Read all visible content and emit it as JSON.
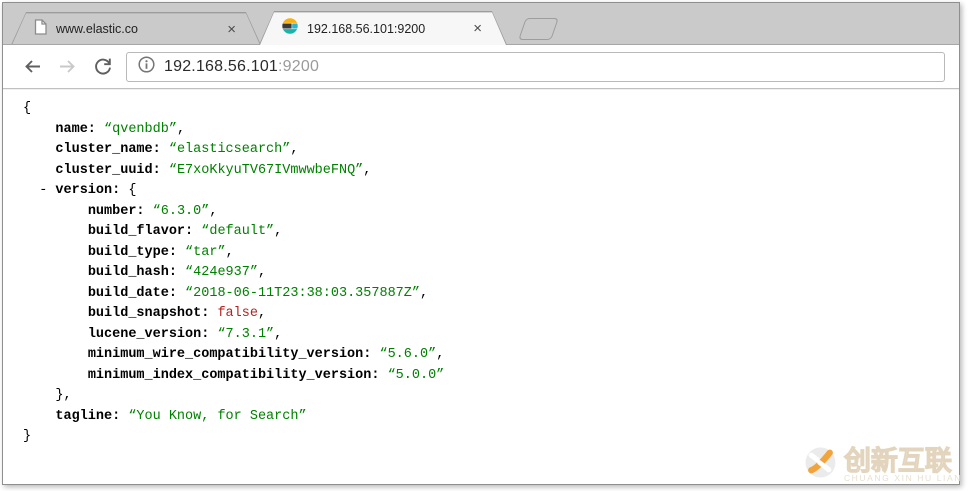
{
  "browser": {
    "tabs": [
      {
        "title": "www.elastic.co",
        "icon": "page-icon",
        "close_label": "×",
        "active": false
      },
      {
        "title": "192.168.56.101:9200",
        "icon": "elasticsearch-icon",
        "close_label": "×",
        "active": true
      }
    ],
    "address_bar": {
      "host": "192.168.56.101",
      "port": ":9200"
    }
  },
  "json_viewer": {
    "colors": {
      "key": "#000000",
      "punct": "#000000",
      "string": "#008000",
      "bool": "#b22222"
    },
    "lines": [
      [
        [
          "p",
          "{"
        ]
      ],
      [
        [
          "p",
          "    "
        ],
        [
          "k",
          "name:"
        ],
        [
          "p",
          " "
        ],
        [
          "s",
          "“qvenbdb”"
        ],
        [
          "p",
          ","
        ]
      ],
      [
        [
          "p",
          "    "
        ],
        [
          "k",
          "cluster_name:"
        ],
        [
          "p",
          " "
        ],
        [
          "s",
          "“elasticsearch”"
        ],
        [
          "p",
          ","
        ]
      ],
      [
        [
          "p",
          "    "
        ],
        [
          "k",
          "cluster_uuid:"
        ],
        [
          "p",
          " "
        ],
        [
          "s",
          "“E7xoKkyuTV67IVmwwbeFNQ”"
        ],
        [
          "p",
          ","
        ]
      ],
      [
        [
          "p",
          "  - "
        ],
        [
          "k",
          "version:"
        ],
        [
          "p",
          " {"
        ]
      ],
      [
        [
          "p",
          "        "
        ],
        [
          "k",
          "number:"
        ],
        [
          "p",
          " "
        ],
        [
          "s",
          "“6.3.0”"
        ],
        [
          "p",
          ","
        ]
      ],
      [
        [
          "p",
          "        "
        ],
        [
          "k",
          "build_flavor:"
        ],
        [
          "p",
          " "
        ],
        [
          "s",
          "“default”"
        ],
        [
          "p",
          ","
        ]
      ],
      [
        [
          "p",
          "        "
        ],
        [
          "k",
          "build_type:"
        ],
        [
          "p",
          " "
        ],
        [
          "s",
          "“tar”"
        ],
        [
          "p",
          ","
        ]
      ],
      [
        [
          "p",
          "        "
        ],
        [
          "k",
          "build_hash:"
        ],
        [
          "p",
          " "
        ],
        [
          "s",
          "“424e937”"
        ],
        [
          "p",
          ","
        ]
      ],
      [
        [
          "p",
          "        "
        ],
        [
          "k",
          "build_date:"
        ],
        [
          "p",
          " "
        ],
        [
          "s",
          "“2018-06-11T23:38:03.357887Z”"
        ],
        [
          "p",
          ","
        ]
      ],
      [
        [
          "p",
          "        "
        ],
        [
          "k",
          "build_snapshot:"
        ],
        [
          "p",
          " "
        ],
        [
          "b",
          "false"
        ],
        [
          "p",
          ","
        ]
      ],
      [
        [
          "p",
          "        "
        ],
        [
          "k",
          "lucene_version:"
        ],
        [
          "p",
          " "
        ],
        [
          "s",
          "“7.3.1”"
        ],
        [
          "p",
          ","
        ]
      ],
      [
        [
          "p",
          "        "
        ],
        [
          "k",
          "minimum_wire_compatibility_version:"
        ],
        [
          "p",
          " "
        ],
        [
          "s",
          "“5.6.0”"
        ],
        [
          "p",
          ","
        ]
      ],
      [
        [
          "p",
          "        "
        ],
        [
          "k",
          "minimum_index_compatibility_version:"
        ],
        [
          "p",
          " "
        ],
        [
          "s",
          "“5.0.0”"
        ]
      ],
      [
        [
          "p",
          "    },"
        ]
      ],
      [
        [
          "p",
          "    "
        ],
        [
          "k",
          "tagline:"
        ],
        [
          "p",
          " "
        ],
        [
          "s",
          "“You Know, for Search”"
        ]
      ],
      [
        [
          "p",
          "}"
        ]
      ]
    ]
  },
  "watermark": {
    "title": "创新互联",
    "subtitle": "CHUANG XIN HU LIAN",
    "accent_color": "#f2a33c"
  }
}
